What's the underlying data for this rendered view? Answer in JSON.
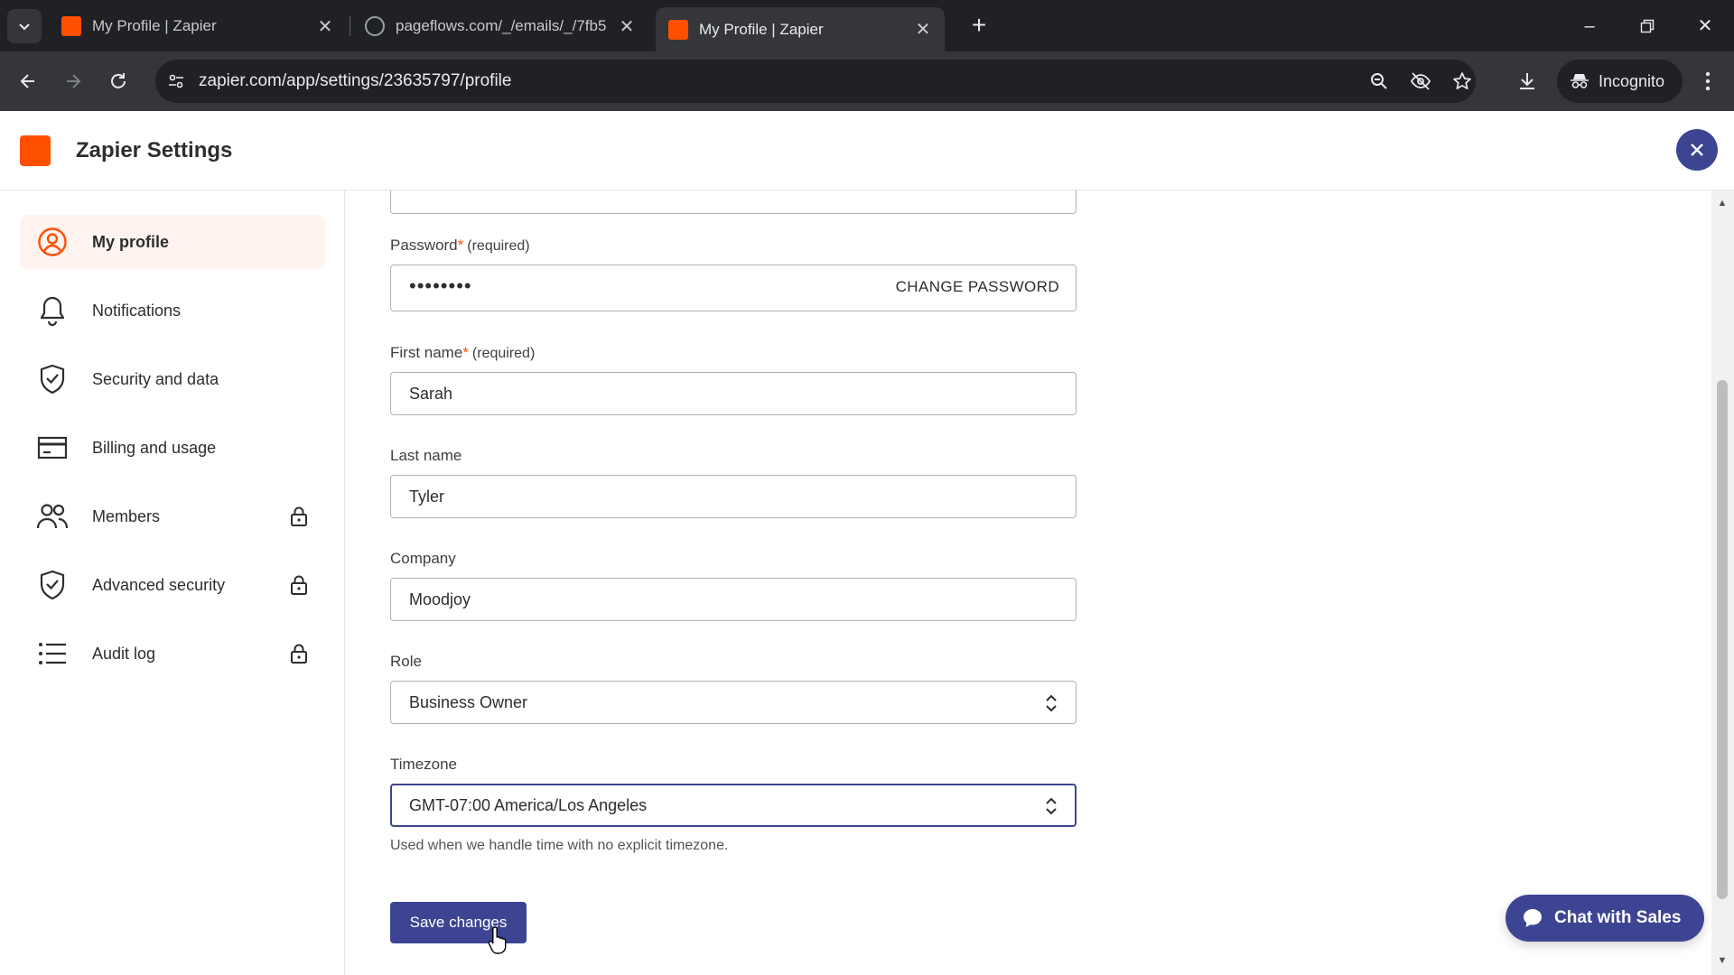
{
  "browser": {
    "tabs": [
      {
        "title": "My Profile | Zapier",
        "favicon": "zapier-icon",
        "active": false
      },
      {
        "title": "pageflows.com/_/emails/_/7fb5",
        "favicon": "globe-icon",
        "active": false
      },
      {
        "title": "My Profile | Zapier",
        "favicon": "zapier-icon",
        "active": true
      }
    ],
    "url": "zapier.com/app/settings/23635797/profile",
    "incognito_label": "Incognito"
  },
  "app": {
    "title": "Zapier Settings",
    "brand_color": "#ff4f00",
    "accent_color": "#3d4592"
  },
  "sidebar": {
    "items": [
      {
        "label": "My profile",
        "icon": "user-circle-icon",
        "active": true,
        "locked": false
      },
      {
        "label": "Notifications",
        "icon": "bell-icon",
        "active": false,
        "locked": false
      },
      {
        "label": "Security and data",
        "icon": "shield-check-icon",
        "active": false,
        "locked": false
      },
      {
        "label": "Billing and usage",
        "icon": "credit-card-icon",
        "active": false,
        "locked": false
      },
      {
        "label": "Members",
        "icon": "users-icon",
        "active": false,
        "locked": true
      },
      {
        "label": "Advanced security",
        "icon": "shield-check-icon",
        "active": false,
        "locked": true
      },
      {
        "label": "Audit log",
        "icon": "list-icon",
        "active": false,
        "locked": true
      }
    ]
  },
  "form": {
    "password": {
      "label": "Password",
      "required_text": "(required)",
      "value": "••••••••",
      "action": "CHANGE PASSWORD"
    },
    "first_name": {
      "label": "First name",
      "required_text": "(required)",
      "value": "Sarah"
    },
    "last_name": {
      "label": "Last name",
      "value": "Tyler"
    },
    "company": {
      "label": "Company",
      "value": "Moodjoy"
    },
    "role": {
      "label": "Role",
      "value": "Business Owner"
    },
    "timezone": {
      "label": "Timezone",
      "value": "GMT-07:00 America/Los Angeles",
      "hint": "Used when we handle time with no explicit timezone."
    },
    "save_label": "Save changes",
    "required_mark": "*"
  },
  "chat": {
    "label": "Chat with Sales"
  }
}
